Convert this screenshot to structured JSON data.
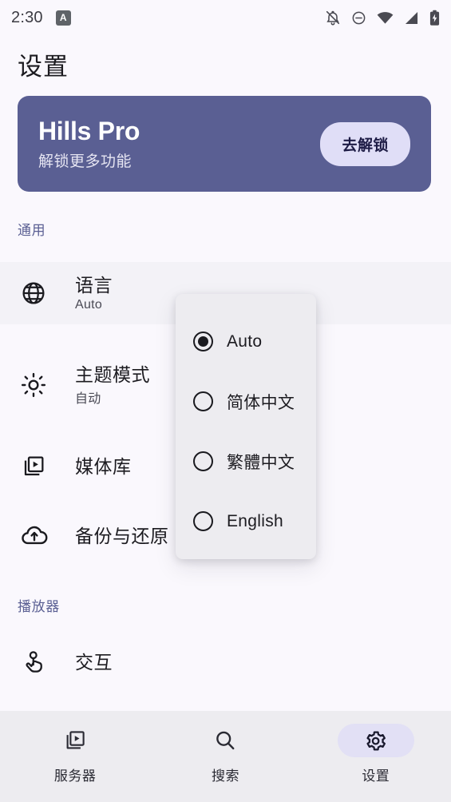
{
  "status_bar": {
    "time": "2:30",
    "app_badge": "A",
    "icons": [
      "notifications-off-icon",
      "do-not-disturb-icon",
      "wifi-icon",
      "cellular-signal-icon",
      "battery-charging-icon"
    ]
  },
  "header": {
    "title": "设置"
  },
  "pro_banner": {
    "title": "Hills Pro",
    "subtitle": "解锁更多功能",
    "button_label": "去解锁",
    "bg_color": "#5A5F93",
    "button_bg_color": "#E0DEF7",
    "button_text_color": "#1D1B45"
  },
  "sections": [
    {
      "id": "general",
      "header": "通用",
      "items": [
        {
          "icon": "globe-icon",
          "label": "语言",
          "value": "Auto"
        },
        {
          "icon": "brightness-icon",
          "label": "主题模式",
          "value": "自动"
        },
        {
          "icon": "media-library-icon",
          "label": "媒体库",
          "value": ""
        },
        {
          "icon": "cloud-upload-icon",
          "label": "备份与还原",
          "value": ""
        }
      ]
    },
    {
      "id": "player",
      "header": "播放器",
      "items": [
        {
          "icon": "touch-gesture-icon",
          "label": "交互",
          "value": ""
        }
      ]
    }
  ],
  "language_dialog": {
    "bg_color": "#EDECF0",
    "options": [
      {
        "label": "Auto",
        "selected": true
      },
      {
        "label": "简体中文",
        "selected": false
      },
      {
        "label": "繁體中文",
        "selected": false
      },
      {
        "label": "English",
        "selected": false
      }
    ]
  },
  "bottom_nav": {
    "active_pill_color": "#E2E0F5",
    "items": [
      {
        "icon": "media-library-icon",
        "label": "服务器",
        "active": false
      },
      {
        "icon": "search-icon",
        "label": "搜索",
        "active": false
      },
      {
        "icon": "gear-icon",
        "label": "设置",
        "active": true
      }
    ]
  }
}
